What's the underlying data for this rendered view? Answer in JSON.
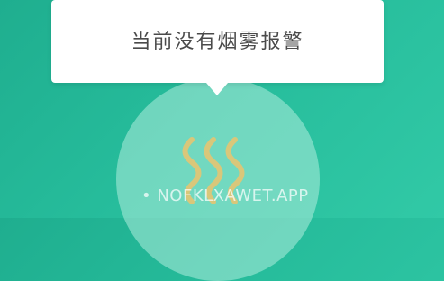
{
  "tooltip": {
    "message": "当前没有烟雾报警"
  },
  "status_icon": {
    "name": "smoke-icon",
    "color": "#d9c77a"
  },
  "watermark": {
    "text": "• NOFKLXAWET.APP"
  },
  "colors": {
    "background": "#26bc9b",
    "tooltip_bg": "#ffffff",
    "tooltip_text": "#4a4a4a"
  }
}
